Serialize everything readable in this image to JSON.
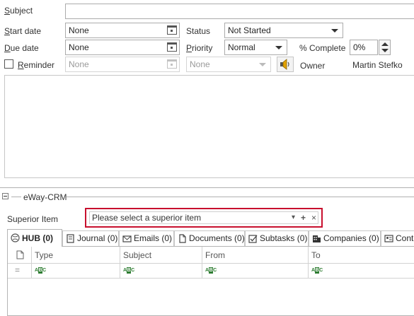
{
  "form": {
    "subject_label": "Subject",
    "subject_value": "",
    "start_date_label": "Start date",
    "start_date_value": "None",
    "due_date_label": "Due date",
    "due_date_value": "None",
    "reminder_label": "Reminder",
    "reminder_date_value": "None",
    "reminder_time_value": "None",
    "status_label": "Status",
    "status_value": "Not Started",
    "priority_label": "Priority",
    "priority_value": "Normal",
    "complete_label": "% Complete",
    "complete_value": "0%",
    "owner_label": "Owner",
    "owner_value": "Martin Stefko",
    "notes_value": ""
  },
  "eway": {
    "section_title": "eWay-CRM",
    "superior_label": "Superior Item",
    "superior_placeholder": "Please select a superior item",
    "superior_dropdown_glyph": "▾",
    "superior_add_glyph": "+",
    "superior_clear_glyph": "×",
    "tabs": [
      {
        "label": "HUB (0)",
        "icon": "hub-icon",
        "active": true
      },
      {
        "label": "Journal (0)",
        "icon": "journal-icon"
      },
      {
        "label": "Emails (0)",
        "icon": "email-icon"
      },
      {
        "label": "Documents (0)",
        "icon": "document-icon"
      },
      {
        "label": "Subtasks (0)",
        "icon": "subtask-icon"
      },
      {
        "label": "Companies (0)",
        "icon": "company-icon"
      },
      {
        "label": "Cont",
        "icon": "contact-icon"
      }
    ],
    "grid": {
      "columns": [
        "Type",
        "Subject",
        "From",
        "To"
      ],
      "filter_row_glyph": "="
    }
  },
  "colors": {
    "highlight_border": "#c8102e",
    "abc_filter_green": "#2e7d32"
  }
}
